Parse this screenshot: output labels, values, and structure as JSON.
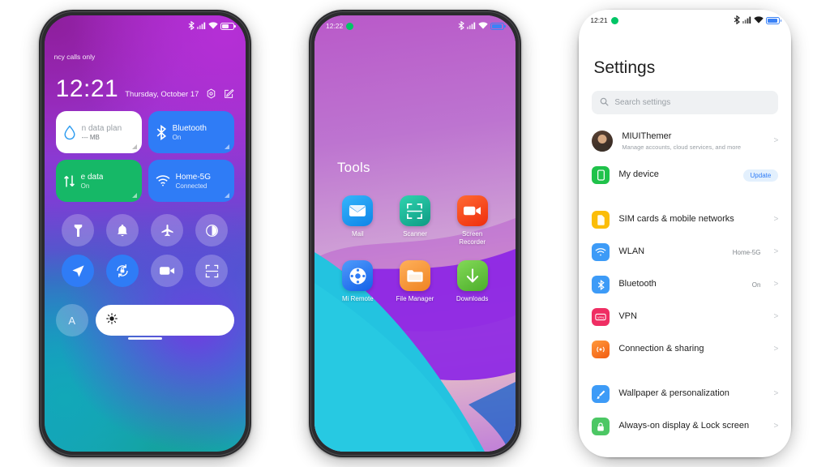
{
  "phones": {
    "control_center": {
      "status": {
        "carrier": "ncy calls only",
        "icons": [
          "bluetooth-icon",
          "signal-icon",
          "wifi-icon",
          "battery-icon"
        ]
      },
      "clock": {
        "time": "12:21",
        "date": "Thursday, October 17",
        "icons": [
          "settings-hex-icon",
          "edit-icon"
        ]
      },
      "tiles": [
        {
          "title": "n data plan",
          "sub": "--- MB",
          "icon": "water-drop-icon",
          "style": "white"
        },
        {
          "title": "Bluetooth",
          "sub": "On",
          "icon": "bluetooth-icon",
          "style": "blue"
        },
        {
          "title": "e data",
          "sub": "On",
          "icon": "data-arrows-icon",
          "style": "green"
        },
        {
          "title": "Home-5G",
          "sub": "Connected",
          "icon": "wifi-icon",
          "style": "blue"
        }
      ],
      "toggles": [
        {
          "name": "flashlight-icon",
          "active": false
        },
        {
          "name": "bell-icon",
          "active": false
        },
        {
          "name": "airplane-icon",
          "active": false
        },
        {
          "name": "dark-mode-icon",
          "active": false
        },
        {
          "name": "location-icon",
          "active": true
        },
        {
          "name": "auto-rotate-icon",
          "active": true
        },
        {
          "name": "screen-record-icon",
          "active": false
        },
        {
          "name": "scan-icon",
          "active": false
        }
      ],
      "brightness": {
        "auto_label": "A",
        "icon": "brightness-icon"
      }
    },
    "folder": {
      "status": {
        "time": "12:22",
        "badge": "green-dot-icon"
      },
      "folder_name": "Tools",
      "apps": [
        {
          "label": "Mail",
          "icon": "mail-icon",
          "color": "#1f9bf0"
        },
        {
          "label": "Scanner",
          "icon": "scanner-icon",
          "color": "#18b89a"
        },
        {
          "label": "Screen Recorder",
          "icon": "screen-recorder-icon",
          "color": "#f5441f"
        },
        {
          "label": "Mi Remote",
          "icon": "remote-icon",
          "color": "#2f7cf6"
        },
        {
          "label": "File Manager",
          "icon": "folder-icon",
          "color": "#f0963c"
        },
        {
          "label": "Downloads",
          "icon": "download-icon",
          "color": "#5fc23b"
        }
      ]
    },
    "settings": {
      "status": {
        "time": "12:21",
        "badge": "green-dot-icon"
      },
      "title": "Settings",
      "search": {
        "placeholder": "Search settings",
        "icon": "search-icon"
      },
      "groups": [
        {
          "rows": [
            {
              "title": "MIUIThemer",
              "sub": "Manage accounts, cloud services, and more",
              "icon": "avatar",
              "chevron": ">"
            },
            {
              "title": "My device",
              "badge": "Update",
              "icon": "device-icon",
              "color": "#1fc24a"
            }
          ]
        },
        {
          "rows": [
            {
              "title": "SIM cards & mobile networks",
              "icon": "sim-icon",
              "color": "#fbbd08",
              "chevron": ">"
            },
            {
              "title": "WLAN",
              "value": "Home-5G",
              "icon": "wifi-icon",
              "color": "#3d9bf7",
              "chevron": ">"
            },
            {
              "title": "Bluetooth",
              "value": "On",
              "icon": "bluetooth-icon",
              "color": "#3d9bf7",
              "chevron": ">"
            },
            {
              "title": "VPN",
              "icon": "vpn-icon",
              "color": "#ef2e63",
              "chevron": ">"
            },
            {
              "title": "Connection & sharing",
              "icon": "connection-icon",
              "color": "#f37021",
              "chevron": ">"
            }
          ]
        },
        {
          "rows": [
            {
              "title": "Wallpaper & personalization",
              "icon": "brush-icon",
              "color": "#3d9bf7",
              "chevron": ">"
            },
            {
              "title": "Always-on display & Lock screen",
              "icon": "lock-icon",
              "color": "#4cc764",
              "chevron": ">"
            }
          ]
        }
      ]
    }
  }
}
